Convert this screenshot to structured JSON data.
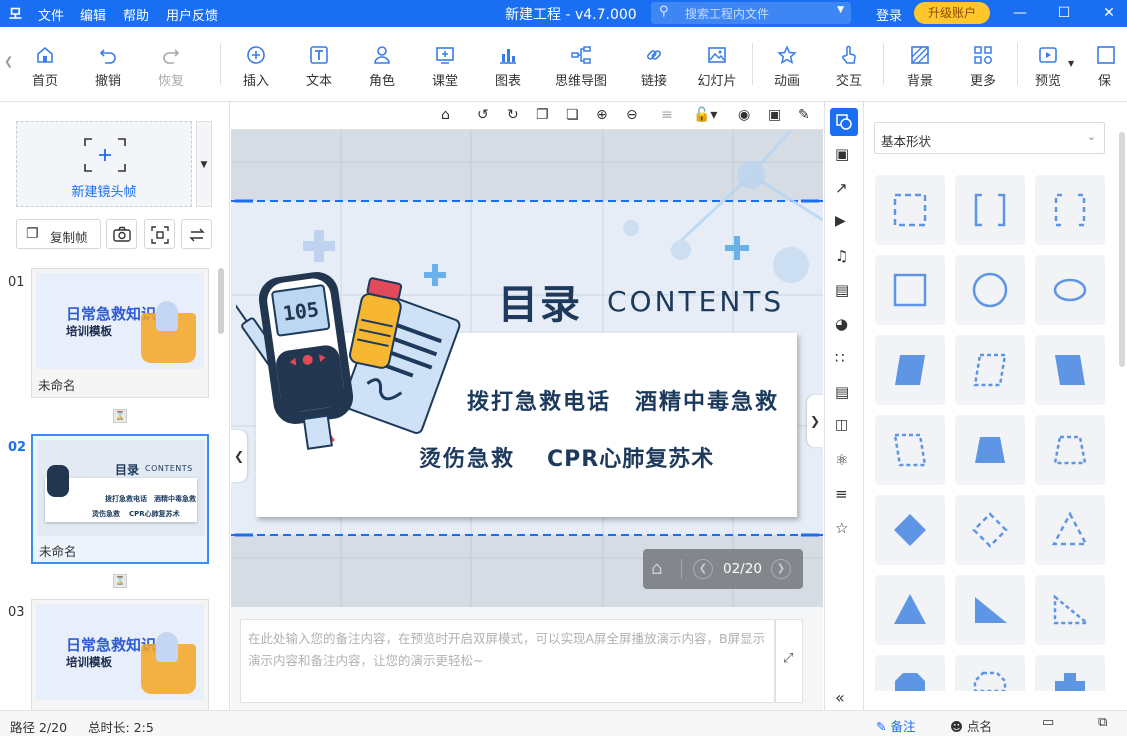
{
  "menu": {
    "file": "文件",
    "edit": "编辑",
    "help": "帮助",
    "feedback": "用户反馈"
  },
  "app": {
    "title": "新建工程 - v4.7.000"
  },
  "search": {
    "placeholder": "搜索工程内文件"
  },
  "account": {
    "login": "登录",
    "upgrade": "升级账户"
  },
  "toolbar": {
    "home": "首页",
    "undo": "撤销",
    "redo": "恢复",
    "insert": "插入",
    "text": "文本",
    "role": "角色",
    "class": "课堂",
    "chart": "图表",
    "mindmap": "思维导图",
    "link": "链接",
    "slides": "幻灯片",
    "animation": "动画",
    "interact": "交互",
    "background": "背景",
    "more": "更多",
    "preview": "预览",
    "save": "保"
  },
  "left": {
    "new_frame": "新建镜头帧",
    "copy_frame": "复制帧",
    "slides": [
      {
        "num": "01",
        "name": "未命名",
        "title": "日常急救知识",
        "subtitle": "培训模板"
      },
      {
        "num": "02",
        "name": "未命名",
        "title": "目录",
        "subtitle": "CONTENTS"
      },
      {
        "num": "03",
        "name": "未命名",
        "title": "日常急救知识",
        "subtitle": "培训模板"
      }
    ]
  },
  "slide": {
    "title": "目录",
    "title_en": "CONTENTS",
    "items": [
      "拨打急救电话",
      "酒精中毒急救",
      "烫伤急救",
      "CPR心肺复苏术"
    ],
    "page": "02/20",
    "meter": "105"
  },
  "notes": {
    "placeholder": "在此处输入您的备注内容，在预览时开启双屏模式，可以实现A屏全屏播放演示内容，B屏显示演示内容和备注内容，让您的演示更轻松~"
  },
  "shapes": {
    "category": "基本形状"
  },
  "status": {
    "path": "路径 2/20",
    "duration": "总时长: 2:5",
    "notes_tab": "备注",
    "rollcall": "点名"
  },
  "colors": {
    "accent": "#1a6ef2",
    "upgrade": "#ffc72c",
    "shape": "#6a9de8",
    "slide_title": "#1d3a5c"
  }
}
